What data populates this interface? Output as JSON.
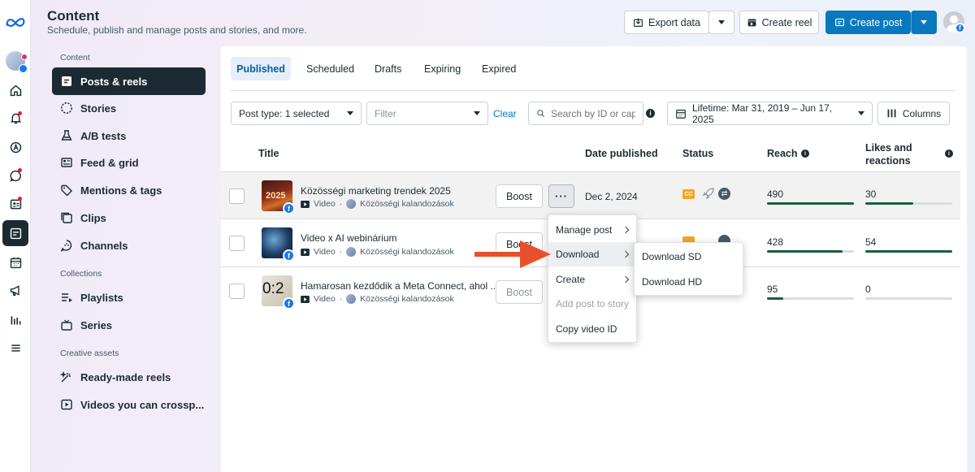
{
  "header": {
    "title": "Content",
    "subtitle": "Schedule, publish and manage posts and stories, and more.",
    "export_label": "Export data",
    "create_reel_label": "Create reel",
    "create_post_label": "Create post"
  },
  "sidebar": {
    "sections": {
      "content": "Content",
      "collections": "Collections",
      "creative": "Creative assets"
    },
    "items": [
      {
        "label": "Posts & reels",
        "icon": "posts-icon",
        "selected": true
      },
      {
        "label": "Stories",
        "icon": "stories-icon"
      },
      {
        "label": "A/B tests",
        "icon": "flask-icon"
      },
      {
        "label": "Feed & grid",
        "icon": "grid-icon"
      },
      {
        "label": "Mentions & tags",
        "icon": "tag-icon"
      },
      {
        "label": "Clips",
        "icon": "clips-icon"
      },
      {
        "label": "Channels",
        "icon": "channels-icon"
      },
      {
        "label": "Playlists",
        "icon": "playlist-icon"
      },
      {
        "label": "Series",
        "icon": "tv-icon"
      },
      {
        "label": "Ready-made reels",
        "icon": "magic-icon"
      },
      {
        "label": "Videos you can crossp...",
        "icon": "video-icon"
      }
    ]
  },
  "tabs": [
    "Published",
    "Scheduled",
    "Drafts",
    "Expiring",
    "Expired"
  ],
  "filters": {
    "post_type": "Post type: 1 selected",
    "filter_placeholder": "Filter",
    "clear": "Clear",
    "search_placeholder": "Search by ID or capti",
    "date_range": "Lifetime: Mar 31, 2019 – Jun 17, 2025",
    "columns": "Columns"
  },
  "table": {
    "headers": {
      "title": "Title",
      "date": "Date published",
      "status": "Status",
      "reach": "Reach",
      "likes_line1": "Likes and",
      "likes_line2": "reactions"
    },
    "rows": [
      {
        "title": "Közösségi marketing trendek 2025",
        "type": "Video",
        "page": "Közösségi kalandozások",
        "boost": "Boost",
        "date": "Dec 2, 2024",
        "reach": "490",
        "reach_fill": 1.0,
        "likes": "30",
        "likes_fill": 0.55
      },
      {
        "title": "Video x AI webinárium",
        "type": "Video",
        "page": "Közösségi kalandozások",
        "boost": "Boost",
        "date": "",
        "reach": "428",
        "reach_fill": 0.87,
        "likes": "54",
        "likes_fill": 1.0
      },
      {
        "title": "Hamarosan kezdődik a Meta Connect, ahol ...",
        "type": "Video",
        "page": "Közösségi kalandozások",
        "boost": "Boost",
        "date": "",
        "reach": "95",
        "reach_fill": 0.19,
        "likes": "0",
        "likes_fill": 0
      }
    ]
  },
  "context_menu": {
    "items": [
      "Manage post",
      "Download",
      "Create",
      "Add post to story",
      "Copy video ID"
    ],
    "submenu": [
      "Download SD",
      "Download HD"
    ]
  },
  "thumb_texts": {
    "row1": "2025",
    "row3": "0:2"
  },
  "colors": {
    "accent": "#0a78be",
    "nav_dark": "#1c2b33",
    "arrow": "#e8502c",
    "bar_fill": "#1d5e3a"
  }
}
